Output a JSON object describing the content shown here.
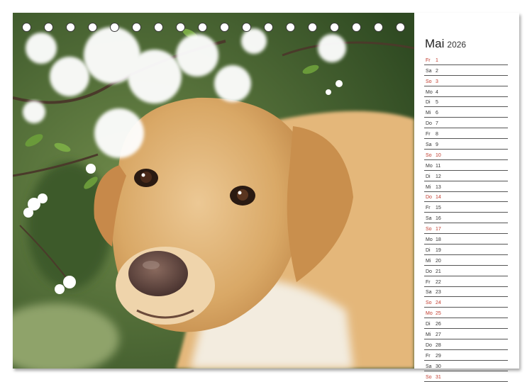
{
  "calendar": {
    "month": "Mai",
    "year": "2026",
    "days": [
      {
        "wd": "Fr",
        "d": "1",
        "hl": true
      },
      {
        "wd": "Sa",
        "d": "2",
        "hl": false
      },
      {
        "wd": "So",
        "d": "3",
        "hl": true
      },
      {
        "wd": "Mo",
        "d": "4",
        "hl": false
      },
      {
        "wd": "Di",
        "d": "5",
        "hl": false
      },
      {
        "wd": "Mi",
        "d": "6",
        "hl": false
      },
      {
        "wd": "Do",
        "d": "7",
        "hl": false
      },
      {
        "wd": "Fr",
        "d": "8",
        "hl": false
      },
      {
        "wd": "Sa",
        "d": "9",
        "hl": false
      },
      {
        "wd": "So",
        "d": "10",
        "hl": true
      },
      {
        "wd": "Mo",
        "d": "11",
        "hl": false
      },
      {
        "wd": "Di",
        "d": "12",
        "hl": false
      },
      {
        "wd": "Mi",
        "d": "13",
        "hl": false
      },
      {
        "wd": "Do",
        "d": "14",
        "hl": true
      },
      {
        "wd": "Fr",
        "d": "15",
        "hl": false
      },
      {
        "wd": "Sa",
        "d": "16",
        "hl": false
      },
      {
        "wd": "So",
        "d": "17",
        "hl": true
      },
      {
        "wd": "Mo",
        "d": "18",
        "hl": false
      },
      {
        "wd": "Di",
        "d": "19",
        "hl": false
      },
      {
        "wd": "Mi",
        "d": "20",
        "hl": false
      },
      {
        "wd": "Do",
        "d": "21",
        "hl": false
      },
      {
        "wd": "Fr",
        "d": "22",
        "hl": false
      },
      {
        "wd": "Sa",
        "d": "23",
        "hl": false
      },
      {
        "wd": "So",
        "d": "24",
        "hl": true
      },
      {
        "wd": "Mo",
        "d": "25",
        "hl": true
      },
      {
        "wd": "Di",
        "d": "26",
        "hl": false
      },
      {
        "wd": "Mi",
        "d": "27",
        "hl": false
      },
      {
        "wd": "Do",
        "d": "28",
        "hl": false
      },
      {
        "wd": "Fr",
        "d": "29",
        "hl": false
      },
      {
        "wd": "Sa",
        "d": "30",
        "hl": false
      },
      {
        "wd": "So",
        "d": "31",
        "hl": true
      }
    ]
  },
  "colors": {
    "holiday": "#c0392b",
    "text": "#333333"
  }
}
